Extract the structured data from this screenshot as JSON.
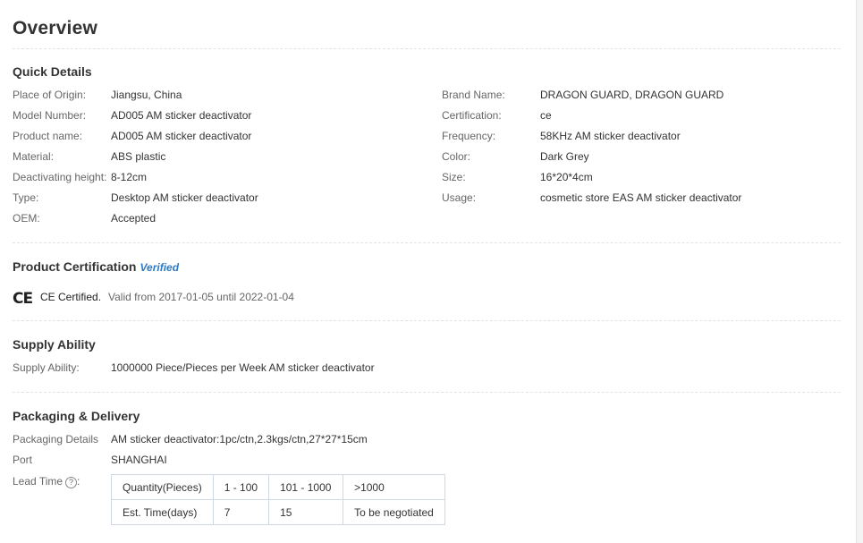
{
  "overview": {
    "title": "Overview"
  },
  "quick_details": {
    "heading": "Quick Details",
    "left": [
      {
        "label": "Place of Origin:",
        "value": "Jiangsu, China"
      },
      {
        "label": "Model Number:",
        "value": "AD005 AM sticker deactivator"
      },
      {
        "label": "Product name:",
        "value": "AD005 AM sticker deactivator"
      },
      {
        "label": "Material:",
        "value": "ABS plastic"
      },
      {
        "label": "Deactivating height:",
        "value": "8-12cm"
      },
      {
        "label": "Type:",
        "value": "Desktop AM sticker deactivator"
      },
      {
        "label": "OEM:",
        "value": "Accepted"
      }
    ],
    "right": [
      {
        "label": "Brand Name:",
        "value": "DRAGON GUARD, DRAGON GUARD"
      },
      {
        "label": "Certification:",
        "value": "ce"
      },
      {
        "label": "Frequency:",
        "value": "58KHz AM sticker deactivator"
      },
      {
        "label": "Color:",
        "value": "Dark Grey"
      },
      {
        "label": "Size:",
        "value": "16*20*4cm"
      },
      {
        "label": "Usage:",
        "value": "cosmetic store EAS AM sticker deactivator"
      }
    ]
  },
  "certification": {
    "heading": "Product Certification",
    "badge": "Verified",
    "mark": "CE",
    "name": "CE Certified.",
    "valid": "Valid from 2017-01-05 until 2022-01-04"
  },
  "supply": {
    "heading": "Supply Ability",
    "label": "Supply Ability:",
    "value": "1000000 Piece/Pieces per Week AM sticker deactivator"
  },
  "packaging": {
    "heading": "Packaging & Delivery",
    "details_label": "Packaging Details",
    "details_value": "AM sticker deactivator:1pc/ctn,2.3kgs/ctn,27*27*15cm",
    "port_label": "Port",
    "port_value": "SHANGHAI",
    "lead_label": "Lead Time",
    "lead_icon": "help-circle-icon",
    "lead_table": [
      [
        "Quantity(Pieces)",
        "1 - 100",
        "101 - 1000",
        ">1000"
      ],
      [
        "Est. Time(days)",
        "7",
        "15",
        "To be negotiated"
      ]
    ]
  }
}
